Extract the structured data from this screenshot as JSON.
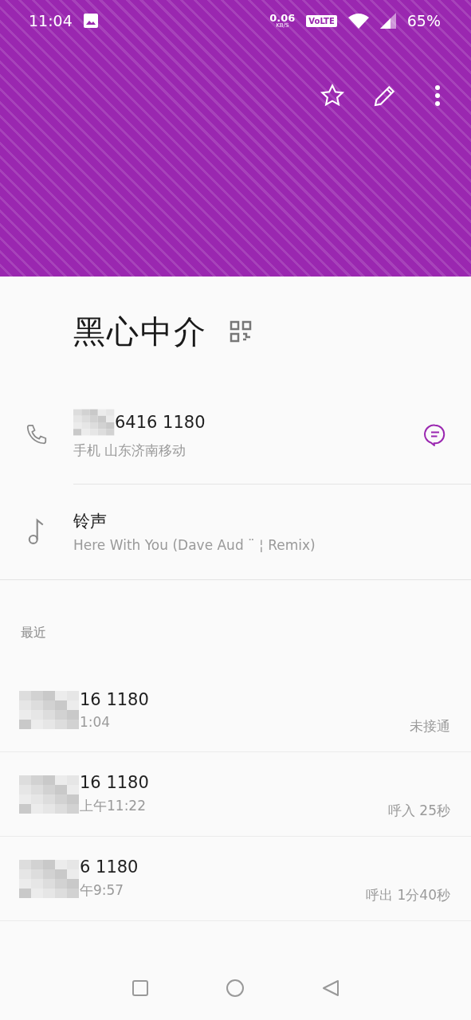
{
  "status_bar": {
    "time": "11:04",
    "speed": "0.06",
    "speed_unit": "KB/S",
    "volte": "VoLTE",
    "battery": "65%"
  },
  "contact": {
    "name": "黑心中介"
  },
  "details": [
    {
      "kind": "phone",
      "title": "6416 1180",
      "subtitle": "手机 山东济南移动",
      "redacted": true
    },
    {
      "kind": "ringtone",
      "title": "铃声",
      "subtitle": "Here With You (Dave Aud ¨ ¦ Remix)",
      "redacted": false
    }
  ],
  "recent": {
    "heading": "最近",
    "calls": [
      {
        "number": "16 1180",
        "time": "1:04",
        "result": "未接通"
      },
      {
        "number": "16 1180",
        "time": "上午11:22",
        "result": "呼入 25秒"
      },
      {
        "number": "6 1180",
        "time": "午9:57",
        "result": "呼出 1分40秒"
      }
    ]
  }
}
